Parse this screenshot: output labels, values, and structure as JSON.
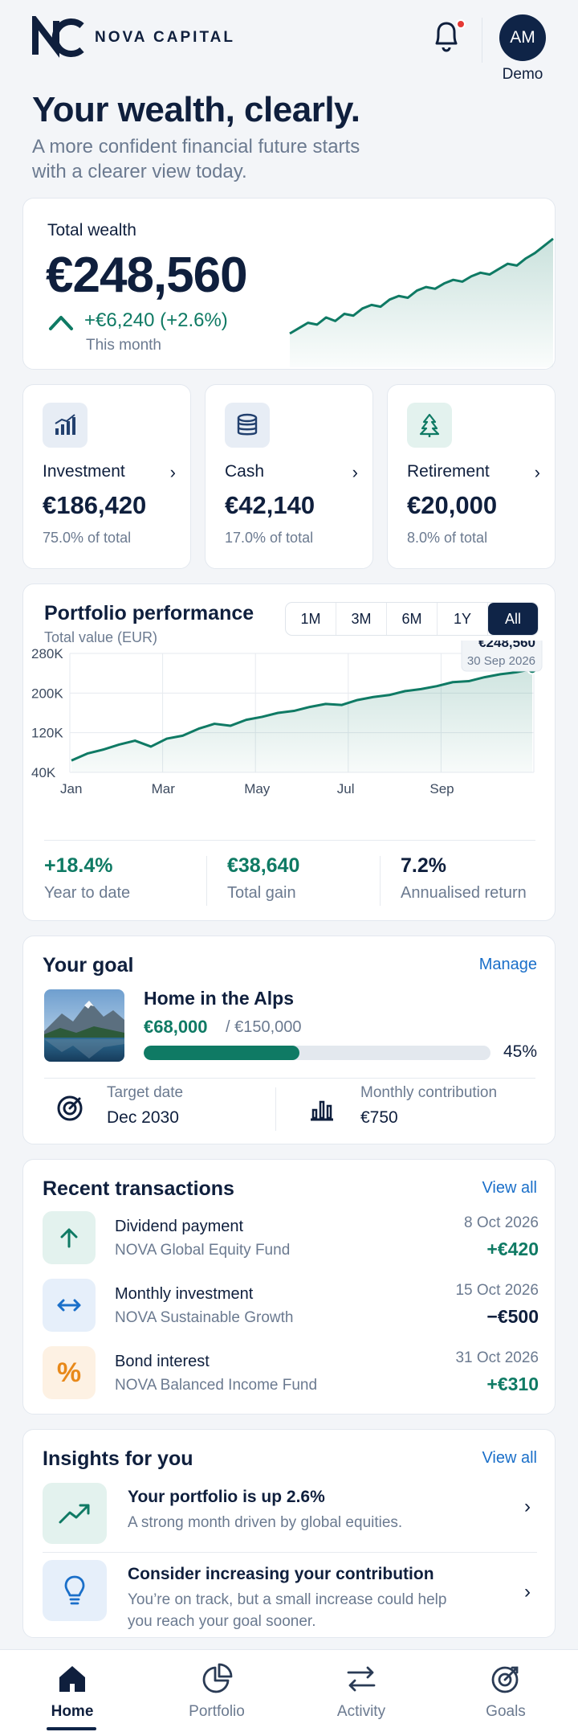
{
  "header": {
    "brand": "NOVA CAPITAL",
    "avatar_initials": "AM",
    "avatar_name": "Demo"
  },
  "hero": {
    "title": "Your wealth, clearly.",
    "subtitle": "A more confident financial future starts with a clearer view today."
  },
  "total_wealth": {
    "label": "Total wealth",
    "value": "€248,560",
    "change": "+€6,240 (+2.6%)",
    "period": "This month"
  },
  "accounts": [
    {
      "name": "Investment",
      "value": "€186,420",
      "share": "75.0% of total",
      "icon": "bar-chart-icon"
    },
    {
      "name": "Cash",
      "value": "€42,140",
      "share": "17.0% of total",
      "icon": "coins-icon"
    },
    {
      "name": "Retirement",
      "value": "€20,000",
      "share": "8.0% of total",
      "icon": "tree-icon"
    }
  ],
  "performance": {
    "title": "Portfolio performance",
    "subtitle": "Total value (EUR)",
    "ranges": [
      "1M",
      "3M",
      "6M",
      "1Y",
      "All"
    ],
    "active_range": "All",
    "tooltip_value": "€248,560",
    "tooltip_date": "30 Sep 2026",
    "stats": [
      {
        "value": "+18.4%",
        "label": "Year to date",
        "color": "#0f7a64"
      },
      {
        "value": "€38,640",
        "label": "Total gain",
        "color": "#0f7a64"
      },
      {
        "value": "7.2%",
        "label": "Annualised return",
        "color": "#0f1f3d"
      }
    ]
  },
  "chart_data": {
    "type": "area",
    "title": "Portfolio performance",
    "ylabel": "Total value (EUR)",
    "x_ticks": [
      "Jan",
      "Mar",
      "May",
      "Jul",
      "Sep"
    ],
    "y_ticks": [
      "280K",
      "200K",
      "120K",
      "40K"
    ],
    "y_tick_values": [
      280000,
      200000,
      120000,
      40000
    ],
    "ylim": [
      40000,
      280000
    ],
    "grid": true,
    "series": [
      {
        "values": [
          64000,
          78000,
          86000,
          96000,
          104000,
          92000,
          108000,
          114000,
          128000,
          138000,
          134000,
          146000,
          152000,
          160000,
          164000,
          172000,
          178000,
          176000,
          186000,
          192000,
          196000,
          204000,
          208000,
          214000,
          222000,
          224000,
          232000,
          238000,
          242000,
          248560
        ]
      }
    ]
  },
  "sparkline": {
    "values": [
      40,
      46,
      52,
      50,
      58,
      54,
      62,
      60,
      68,
      72,
      70,
      78,
      82,
      80,
      88,
      92,
      90,
      96,
      100,
      98,
      104,
      108,
      106,
      112,
      118,
      116,
      124,
      130,
      138,
      146
    ]
  },
  "goal": {
    "title": "Your goal",
    "manage_label": "Manage",
    "name": "Home in the Alps",
    "current": "€68,000",
    "target": "/ €150,000",
    "progress_percent": 45,
    "progress_label": "45%",
    "target_date_label": "Target date",
    "target_date": "Dec 2030",
    "contribution_label": "Monthly contribution",
    "contribution": "€750"
  },
  "transactions": {
    "title": "Recent transactions",
    "view_all": "View all",
    "items": [
      {
        "name": "Dividend payment",
        "fund": "NOVA Global Equity Fund",
        "date": "8 Oct 2026",
        "amount": "+€420",
        "icon": "arrow-up-icon",
        "amount_color": "#0f7a64"
      },
      {
        "name": "Monthly investment",
        "fund": "NOVA Sustainable Growth",
        "date": "15 Oct 2026",
        "amount": "−€500",
        "icon": "swap-arrows-icon",
        "amount_color": "#0f1f3d"
      },
      {
        "name": "Bond interest",
        "fund": "NOVA Balanced Income Fund",
        "date": "31 Oct 2026",
        "amount": "+€310",
        "icon": "percent-icon",
        "amount_color": "#0f7a64"
      }
    ]
  },
  "insights": {
    "title": "Insights for you",
    "view_all": "View all",
    "items": [
      {
        "title": "Your portfolio is up 2.6%",
        "text": "A strong month driven by global equities.",
        "icon": "trend-up-icon"
      },
      {
        "title": "Consider increasing your contribution",
        "text": "You’re on track, but a small increase could help you reach your goal sooner.",
        "icon": "lightbulb-icon"
      }
    ]
  },
  "nav": {
    "items": [
      {
        "label": "Home",
        "icon": "home-icon",
        "active": true
      },
      {
        "label": "Portfolio",
        "icon": "pie-chart-icon",
        "active": false
      },
      {
        "label": "Activity",
        "icon": "swap-icon",
        "active": false
      },
      {
        "label": "Goals",
        "icon": "target-icon",
        "active": false
      }
    ]
  },
  "colors": {
    "brand_navy": "#0f2447",
    "accent_green": "#0f7a64",
    "link_blue": "#1a6fc9",
    "alert_red": "#e53935"
  }
}
